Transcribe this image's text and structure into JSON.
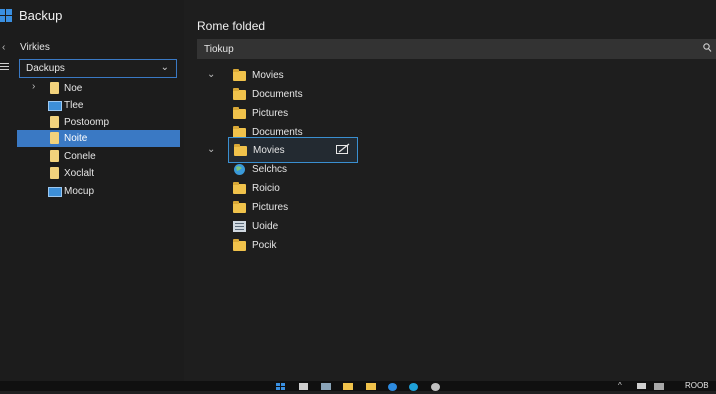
{
  "app": {
    "title": "Backup"
  },
  "sidebar": {
    "section_label": "Virkies",
    "dropdown_value": "Dackups",
    "items": [
      {
        "label": "Noe",
        "icon": "doc-icon"
      },
      {
        "label": "Tlee",
        "icon": "monitor-icon"
      },
      {
        "label": "Postoomp",
        "icon": "doc-icon"
      },
      {
        "label": "Noite",
        "icon": "doc-icon",
        "selected": true
      },
      {
        "label": "Conele",
        "icon": "doc-icon"
      },
      {
        "label": "Xoclalt",
        "icon": "doc-icon"
      },
      {
        "label": "Mocup",
        "icon": "monitor-icon"
      }
    ]
  },
  "main": {
    "heading": "Rome folded",
    "search_value": "Tiokup",
    "group_a": [
      {
        "label": "Movies"
      },
      {
        "label": "Documents"
      },
      {
        "label": "Pictures"
      },
      {
        "label": "Documents"
      }
    ],
    "selected_item": {
      "label": "Movies"
    },
    "group_b": [
      {
        "label": "Selchcs",
        "icon": "globe-icon"
      },
      {
        "label": "Roicio",
        "icon": "folder-icon"
      },
      {
        "label": "Pictures",
        "icon": "folder-icon"
      },
      {
        "label": "Uoide",
        "icon": "list-icon"
      },
      {
        "label": "Pocik",
        "icon": "folder-icon"
      }
    ]
  },
  "taskbar": {
    "clock": "ROOB"
  },
  "colors": {
    "accent": "#3a79c4",
    "folder": "#f0c24b",
    "selection_border": "#3a8fd0"
  }
}
